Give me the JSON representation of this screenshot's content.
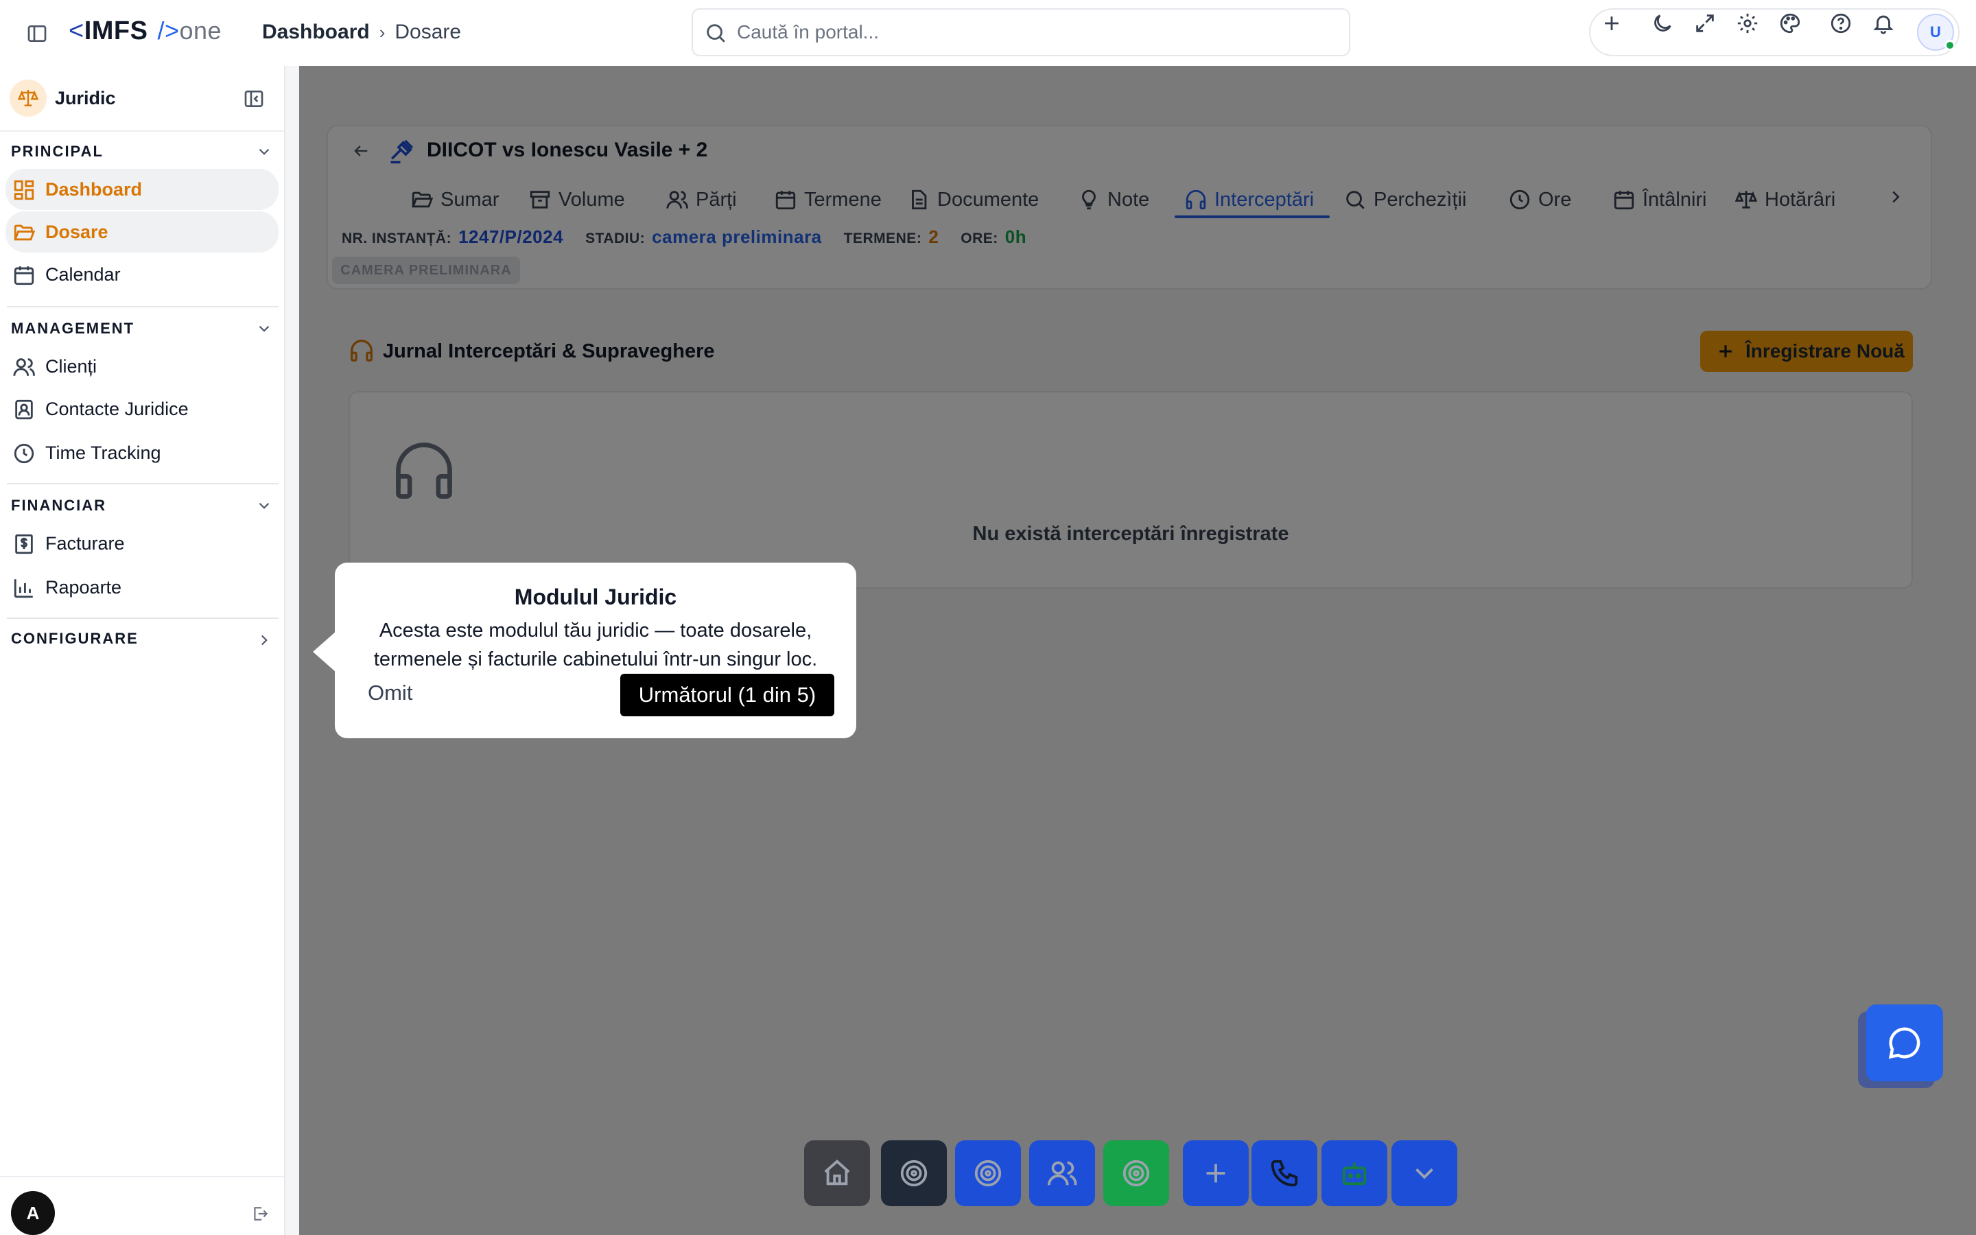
{
  "topbar": {
    "logo_lt": "<",
    "logo_brand": "IMFS",
    "logo_slash": "/>",
    "logo_one": "one",
    "breadcrumb": [
      "Dashboard",
      "Dosare"
    ],
    "search_placeholder": "Caută în portal...",
    "user_initial": "U"
  },
  "sidebar": {
    "module_name": "Juridic",
    "sections": [
      {
        "title": "PRINCIPAL",
        "items": [
          {
            "label": "Dashboard",
            "icon": "dashboard-icon",
            "active": true
          },
          {
            "label": "Dosare",
            "icon": "folder-icon",
            "active": true
          },
          {
            "label": "Calendar",
            "icon": "calendar-icon",
            "active": false
          }
        ]
      },
      {
        "title": "MANAGEMENT",
        "items": [
          {
            "label": "Clienți",
            "icon": "users-icon",
            "active": false
          },
          {
            "label": "Contacte Juridice",
            "icon": "contact-card-icon",
            "active": false
          },
          {
            "label": "Time Tracking",
            "icon": "clock-icon",
            "active": false
          }
        ]
      },
      {
        "title": "FINANCIAR",
        "items": [
          {
            "label": "Facturare",
            "icon": "invoice-icon",
            "active": false
          },
          {
            "label": "Rapoarte",
            "icon": "bar-chart-icon",
            "active": false
          }
        ]
      },
      {
        "title": "CONFIGURARE",
        "items": []
      }
    ],
    "footer_initial": "A"
  },
  "case": {
    "title": "DIICOT vs Ionescu Vasile + 2",
    "tabs": [
      "Sumar",
      "Volume",
      "Părți",
      "Termene",
      "Documente",
      "Note",
      "Interceptări",
      "Perchezìții",
      "Ore",
      "Întâlniri",
      "Hotărâri"
    ],
    "active_tab": "Interceptări",
    "meta": {
      "nr_label": "NR. INSTANȚĂ:",
      "nr_value": "1247/P/2024",
      "stadiu_label": "STADIU:",
      "stadiu_value": "camera preliminara",
      "termene_label": "TERMENE:",
      "termene_value": "2",
      "ore_label": "ORE:",
      "ore_value": "0h"
    },
    "stage_badge": "CAMERA PRELIMINARA"
  },
  "section": {
    "title": "Jurnal Interceptări & Supraveghere",
    "new_button": "Înregistrare Nouă",
    "empty_text": "Nu există interceptări înregistrate"
  },
  "tour": {
    "title": "Modulul Juridic",
    "description": "Acesta este modulul tău juridic — toate dosarele, termenele și facturile cabinetului într-un singur loc.",
    "skip": "Omit",
    "next": "Următorul (1 din 5)"
  },
  "dock": {
    "colors": [
      "#3f3f46",
      "#1f2937",
      "#1d4ed8",
      "#1d4ed8",
      "#16a34a",
      "#1d4ed8",
      "#1d4ed8",
      "#1d4ed8",
      "#1d4ed8"
    ]
  }
}
